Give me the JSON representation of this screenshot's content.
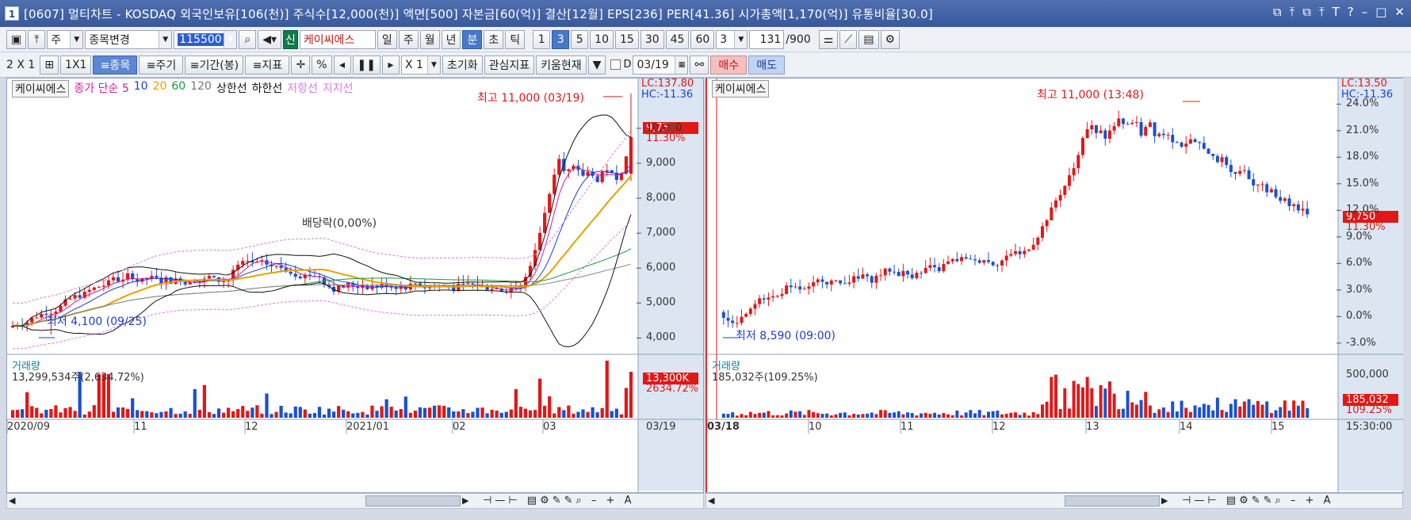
{
  "window": {
    "badge": "1",
    "title": "[0607] 멀티차트 - KOSDAQ 외국인보유[106(천)] 주식수[12,000(천)] 액면[500] 자본금[60(억)] 결산[12월] EPS[236] PER[41.36] 시가총액[1,170(억)] 유통비율[30.0]",
    "controls": [
      "⧉",
      "⤒",
      "⧉",
      "⤒",
      "T",
      "?",
      "–",
      "□",
      "✕"
    ]
  },
  "toolbar1": {
    "stock_type": "주",
    "stock_change": "종목변경",
    "code": "115500",
    "new_badge": "신",
    "stock_name": "케이씨에스",
    "periods": [
      "일",
      "주",
      "월",
      "년",
      "분",
      "초",
      "틱"
    ],
    "active_period": "분",
    "minute_units": [
      "1",
      "3",
      "5",
      "10",
      "15",
      "30",
      "45",
      "60"
    ],
    "active_unit": "3",
    "custom_unit": "3",
    "count": "131",
    "count_max": "/900"
  },
  "toolbar2": {
    "layout_2x1": "2 X 1",
    "layout_1x1": "1X1",
    "btn_stock": "≡종목",
    "btn_cycle": "≡주기",
    "btn_period": "≡기간(봉)",
    "btn_indicator": "≡지표",
    "percent": "%",
    "zoom": "X 1",
    "btn_reset": "초기화",
    "btn_watch": "관심지표",
    "btn_kiwoom": "키움현재",
    "checkbox_label": "D",
    "date_value": "03/19",
    "btn_buy": "매수",
    "btn_sell": "매도"
  },
  "chart_left": {
    "name": "케이씨에스",
    "legend": [
      {
        "text": "종가 단순 5",
        "color": "#d81b9a"
      },
      {
        "text": "10",
        "color": "#1a3fd0"
      },
      {
        "text": "20",
        "color": "#e8a000"
      },
      {
        "text": "60",
        "color": "#1a9a3a"
      },
      {
        "text": "120",
        "color": "#777777"
      },
      {
        "text": "상한선",
        "color": "#111111"
      },
      {
        "text": "하한선",
        "color": "#111111"
      },
      {
        "text": "저항선",
        "color": "#d67ce8"
      },
      {
        "text": "지지선",
        "color": "#d67ce8"
      }
    ],
    "high_label": "최고 11,000 (03/19)",
    "low_label": "최저 4,100 (09/25)",
    "dividend_label": "배당락(0,00%)",
    "lc": "LC:137.80",
    "hc": "HC:-11.36",
    "current_price": "9,750",
    "current_pct": "11.30%",
    "price_ticks": [
      "10,000",
      "9,000",
      "8,000",
      "7,000",
      "6,000",
      "5,000",
      "4,000"
    ],
    "volume_title": "거래량",
    "volume_info": "13,299,534주(2,634.72%)",
    "volume_tag": "13,300K",
    "volume_pct": "2634.72%",
    "x_labels": [
      "2020/09",
      "11",
      "12",
      "2021/01",
      "02",
      "03",
      "03/19"
    ]
  },
  "chart_right": {
    "name": "케이씨에스",
    "high_label": "최고 11,000 (13:48)",
    "low_label": "최저 8,590 (09:00)",
    "lc": "LC:13.50",
    "hc": "HC:-11.36",
    "current_price": "9,750",
    "current_pct": "11.30%",
    "pct_ticks": [
      "24.0%",
      "21.0%",
      "18.0%",
      "15.0%",
      "12.0%",
      "9.0%",
      "6.0%",
      "3.0%",
      "0.0%",
      "-3.0%"
    ],
    "volume_title": "거래량",
    "volume_info": "185,032주(109.25%)",
    "volume_tick": "500,000",
    "volume_tag": "185,032",
    "volume_pct": "109.25%",
    "x_labels": [
      "03/18",
      "10",
      "11",
      "12",
      "13",
      "14",
      "15",
      "15:30:00"
    ]
  },
  "chart_data": [
    {
      "type": "candlestick",
      "title": "",
      "ylabel": "",
      "ylim": [
        3600,
        11200
      ],
      "price_levels": [
        10000,
        9000,
        8000,
        7000,
        6000,
        5000,
        4000
      ],
      "high": 11000,
      "low": 4100,
      "close": 9750,
      "x_categories": [
        "2020/09",
        "11",
        "12",
        "2021/01",
        "02",
        "03",
        "03/19"
      ]
    },
    {
      "type": "candlestick",
      "title": "",
      "ylabel": "",
      "ylim": [
        -4.0,
        26.0
      ],
      "pct_levels": [
        24.0,
        21.0,
        18.0,
        15.0,
        12.0,
        9.0,
        6.0,
        3.0,
        0.0,
        -3.0
      ],
      "high": 11000,
      "low": 8590,
      "close": 9750,
      "x_categories": [
        "03/18",
        "10",
        "11",
        "12",
        "13",
        "14",
        "15",
        "15:30:00"
      ]
    }
  ]
}
